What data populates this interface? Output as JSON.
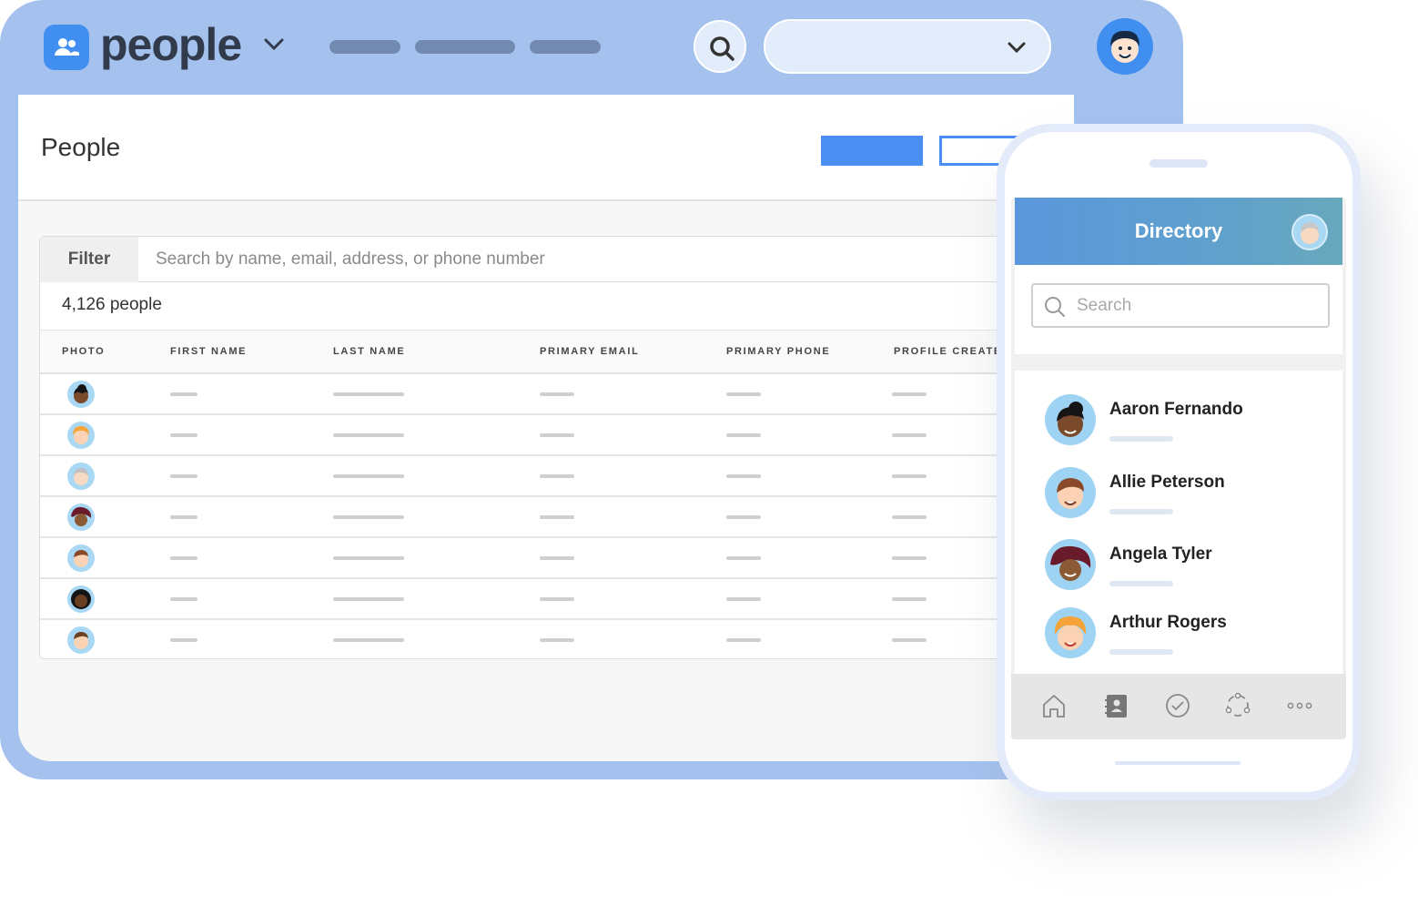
{
  "app": {
    "name": "people"
  },
  "colors": {
    "accent": "#4b8ef3",
    "frame": "#a5c2ef",
    "brand_icon": "#3f8ef0"
  },
  "page": {
    "title": "People",
    "filter_label": "Filter",
    "search_placeholder": "Search by name, email, address, or phone number",
    "count_text": "4,126 people",
    "columns": [
      "PHOTO",
      "FIRST NAME",
      "LAST NAME",
      "PRIMARY EMAIL",
      "PRIMARY PHONE",
      "PROFILE CREATE"
    ]
  },
  "mobile": {
    "header_title": "Directory",
    "search_placeholder": "Search",
    "contacts": [
      {
        "name": "Aaron Fernando"
      },
      {
        "name": "Allie Peterson"
      },
      {
        "name": "Angela Tyler"
      },
      {
        "name": "Arthur Rogers"
      }
    ],
    "tabs": [
      "home-icon",
      "directory-icon",
      "check-icon",
      "groups-icon",
      "more-icon"
    ]
  },
  "icons": {
    "brand": "people-icon",
    "chevron": "chevron-down-icon",
    "search": "search-icon"
  }
}
